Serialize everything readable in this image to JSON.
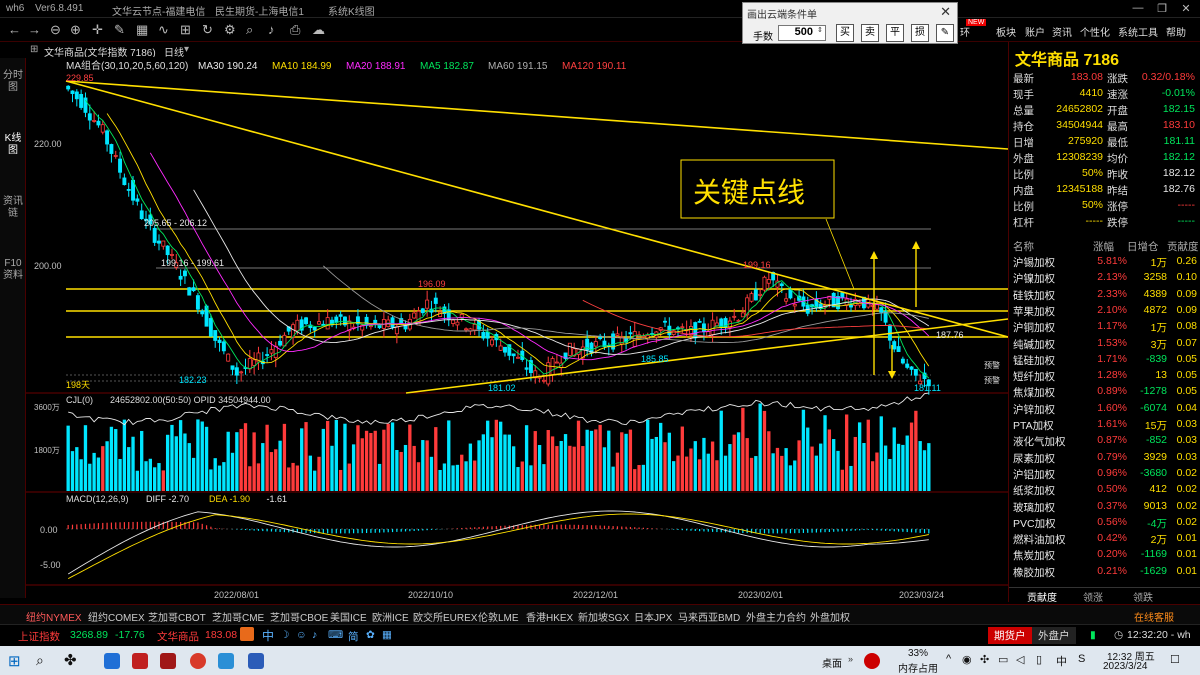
{
  "titlebar": {
    "app": "wh6",
    "version": "Ver6.8.491",
    "server1": "文华云节点-福建电信",
    "server2": "民生期货-上海电信1",
    "window": "系统K线图"
  },
  "dialog": {
    "title": "画出云端条件单",
    "lots_label": "手数",
    "lots_value": "500",
    "buttons": [
      "买",
      "卖",
      "平",
      "损"
    ]
  },
  "toolbar": {
    "menus": [
      "环",
      "板块",
      "账户",
      "资讯",
      "个性化",
      "系统工具",
      "帮助"
    ],
    "new_badge": "NEW"
  },
  "subbar": {
    "symbol": "文华商品(文华指数 7186)",
    "period": "日线"
  },
  "lefttabs": [
    "分时图",
    "K线图",
    "资讯链",
    "F10资料"
  ],
  "chart": {
    "ma_label": "MA组合(30,10,20,5,60,120)",
    "ma_values": [
      {
        "t": "MA30 190.24",
        "c": "#e8e8e8"
      },
      {
        "t": "MA10 184.99",
        "c": "#ffdf00"
      },
      {
        "t": "MA20 188.91",
        "c": "#ff2bff"
      },
      {
        "t": "MA5 182.87",
        "c": "#00e65c"
      },
      {
        "t": "MA60 191.15",
        "c": "#b0b0b0"
      },
      {
        "t": "MA120 190.11",
        "c": "#ff4040"
      }
    ],
    "y_ticks": [
      "220.00",
      "200.00"
    ],
    "price_labels": [
      "229.85",
      "205.65 - 206.12",
      "199.16 - 199.61",
      "196.09",
      "199.16",
      "185.85",
      "182.23",
      "181.02",
      "181.11",
      "187.76"
    ],
    "days_label": "198天",
    "callout": "关键点线",
    "side_labels": [
      "预警",
      "预警"
    ],
    "vol_label": "CJL(0)",
    "vol_values": "24652802.00(50:50)  OPID 34504944.00",
    "vol_ticks": [
      "3600万",
      "1800万"
    ],
    "macd_label": "MACD(12,26,9)",
    "macd_values": [
      {
        "t": "DIFF -2.70",
        "c": "#e8e8e8"
      },
      {
        "t": "DEA -1.90",
        "c": "#ffdf00"
      },
      {
        "t": "-1.61",
        "c": "#e8e8e8"
      }
    ],
    "macd_ticks": [
      "0.00",
      "-5.00"
    ],
    "dates": [
      "2022/08/01",
      "2022/10/10",
      "2022/12/01",
      "2023/02/01",
      "2023/03/24"
    ]
  },
  "quote": {
    "title": "文华商品  7186",
    "rows": [
      {
        "l1": "最新",
        "v1": "183.08",
        "c1": "red",
        "l2": "涨跌",
        "v2": "0.32/0.18%",
        "c2": "red"
      },
      {
        "l1": "现手",
        "v1": "4410",
        "c1": "yel",
        "l2": "速涨",
        "v2": "-0.01%",
        "c2": "grn"
      },
      {
        "l1": "总量",
        "v1": "24652802",
        "c1": "yel",
        "l2": "开盘",
        "v2": "182.15",
        "c2": "grn"
      },
      {
        "l1": "持仓",
        "v1": "34504944",
        "c1": "yel",
        "l2": "最高",
        "v2": "183.10",
        "c2": "red"
      },
      {
        "l1": "日增",
        "v1": "275920",
        "c1": "yel",
        "l2": "最低",
        "v2": "181.11",
        "c2": "grn"
      },
      {
        "l1": "外盘",
        "v1": "12308239",
        "c1": "yel",
        "l2": "均价",
        "v2": "182.12",
        "c2": "grn"
      },
      {
        "l1": "比例",
        "v1": "50%",
        "c1": "yel",
        "l2": "昨收",
        "v2": "182.12",
        "c2": "wht"
      },
      {
        "l1": "内盘",
        "v1": "12345188",
        "c1": "yel",
        "l2": "昨结",
        "v2": "182.76",
        "c2": "wht"
      },
      {
        "l1": "比例",
        "v1": "50%",
        "c1": "yel",
        "l2": "涨停",
        "v2": "-----",
        "c2": "red"
      },
      {
        "l1": "杠杆",
        "v1": "-----",
        "c1": "yel",
        "l2": "跌停",
        "v2": "-----",
        "c2": "grn"
      }
    ]
  },
  "list": {
    "headers": [
      "名称",
      "涨幅",
      "日增仓",
      "贡献度"
    ],
    "rows": [
      [
        "沪锡加权",
        "5.81%",
        "1万",
        "0.26"
      ],
      [
        "沪镍加权",
        "2.13%",
        "3258",
        "0.10"
      ],
      [
        "硅铁加权",
        "2.33%",
        "4389",
        "0.09"
      ],
      [
        "苹果加权",
        "2.10%",
        "4872",
        "0.09"
      ],
      [
        "沪铜加权",
        "1.17%",
        "1万",
        "0.08"
      ],
      [
        "纯碱加权",
        "1.53%",
        "3万",
        "0.07"
      ],
      [
        "锰硅加权",
        "1.71%",
        "-839",
        "0.05"
      ],
      [
        "短纤加权",
        "1.28%",
        "13",
        "0.05"
      ],
      [
        "焦煤加权",
        "0.89%",
        "-1278",
        "0.05"
      ],
      [
        "沪锌加权",
        "1.60%",
        "-6074",
        "0.04"
      ],
      [
        "PTA加权",
        "1.61%",
        "15万",
        "0.03"
      ],
      [
        "液化气加权",
        "0.87%",
        "-852",
        "0.03"
      ],
      [
        "尿素加权",
        "0.79%",
        "3929",
        "0.03"
      ],
      [
        "沪铝加权",
        "0.96%",
        "-3680",
        "0.02"
      ],
      [
        "纸浆加权",
        "0.50%",
        "412",
        "0.02"
      ],
      [
        "玻璃加权",
        "0.37%",
        "9013",
        "0.02"
      ],
      [
        "PVC加权",
        "0.56%",
        "-4万",
        "0.02"
      ],
      [
        "燃料油加权",
        "0.42%",
        "2万",
        "0.01"
      ],
      [
        "焦炭加权",
        "0.20%",
        "-1169",
        "0.01"
      ],
      [
        "橡胶加权",
        "0.21%",
        "-1629",
        "0.01"
      ]
    ],
    "tabs": [
      "贡献度",
      "领涨",
      "领跌"
    ]
  },
  "bottomtabs": [
    "纽约NYMEX",
    "纽约COMEX",
    "芝加哥CBOT",
    "芝加哥CME",
    "芝加哥CBOE",
    "美国ICE",
    "欧洲ICE",
    "欧交所EUREX",
    "伦敦LME",
    "香港HKEX",
    "新加坡SGX",
    "日本JPX",
    "马来西亚BMD",
    "外盘主力合约",
    "外盘加权"
  ],
  "online_service": "在线客服",
  "status": {
    "idx1_name": "上证指数",
    "idx1_val": "3268.89",
    "idx1_chg": "-17.76",
    "idx2_name": "文华商品",
    "idx2_val": "183.08",
    "ime": "中",
    "mode": "简",
    "btn1": "期货户",
    "btn2": "外盘户",
    "clock": "12:32:20 - wh"
  },
  "taskbar": {
    "desktop": "桌面",
    "mem_pct": "33%",
    "mem_label": "内存占用",
    "time": "12:32 周五",
    "date": "2023/3/24"
  }
}
